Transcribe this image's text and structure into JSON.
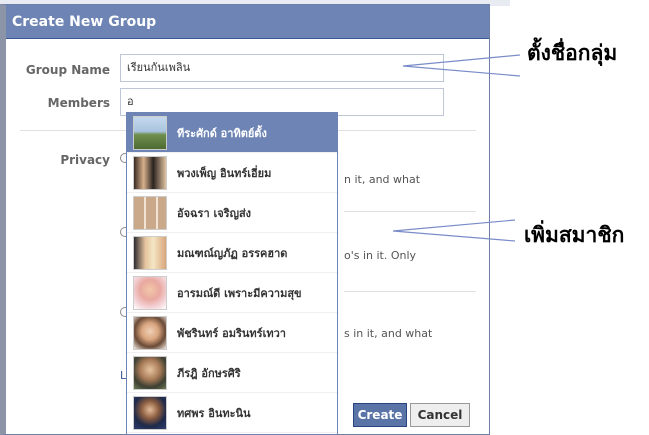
{
  "dialog": {
    "title": "Create New Group",
    "group_name_label": "Group Name",
    "group_name_value": "เรียนกันเพลิน",
    "members_label": "Members",
    "members_value": "อ",
    "privacy_label": "Privacy",
    "privacy_snippets": [
      "n it, and what",
      "o's in it. Only",
      "s in it, and what"
    ],
    "footer_link_fragment": "L",
    "create_label": "Create",
    "cancel_label": "Cancel"
  },
  "dropdown": {
    "selected_index": 0,
    "items": [
      {
        "name": "ทีระศักด์ อาทิตย์ตั้ง",
        "avatar": "landscape-photo"
      },
      {
        "name": "พวงเพ็ญ อินทร์เอี่ยม",
        "avatar": "group-photo"
      },
      {
        "name": "อัจฉรา เจริญส่ง",
        "avatar": "triple-portrait"
      },
      {
        "name": "มณฑณ์ญภัฏ อรรคฮาด",
        "avatar": "couple-photo"
      },
      {
        "name": "อารมณ์ดี เพราะมีความสุข",
        "avatar": "woman-photo"
      },
      {
        "name": "พัชรินทร์ อมรินทร์เทวา",
        "avatar": "woman-photo-2"
      },
      {
        "name": "ภีรฎิ อักษรศิริ",
        "avatar": "portrait-photo"
      },
      {
        "name": "ทศพร อินทะนิน",
        "avatar": "man-photo"
      }
    ]
  },
  "annotations": {
    "group_name_note": "ตั้งชื่อกลุ่ม",
    "members_note": "เพิ่มสมาชิก"
  },
  "colors": {
    "titlebar": "#6d84b4",
    "selected_row": "#6d84b4",
    "create_button": "#5b74a8"
  }
}
